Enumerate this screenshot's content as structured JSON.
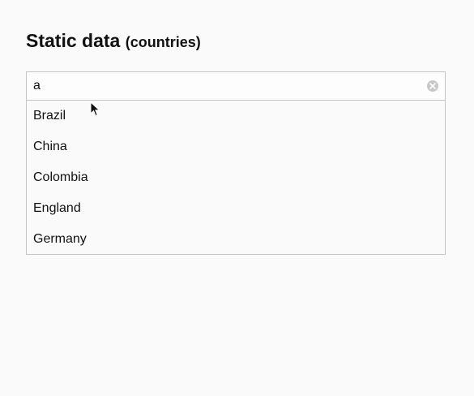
{
  "heading": {
    "title": "Static data",
    "subtitle": "(countries)"
  },
  "search": {
    "value": "a"
  },
  "suggestions": [
    "Brazil",
    "China",
    "Colombia",
    "England",
    "Germany"
  ],
  "icons": {
    "clear": "clear-circle-icon",
    "cursor": "mouse-pointer-icon"
  },
  "colors": {
    "background": "#fafafa",
    "border": "#c4c4c4",
    "clear_icon": "#c8c8c8"
  }
}
